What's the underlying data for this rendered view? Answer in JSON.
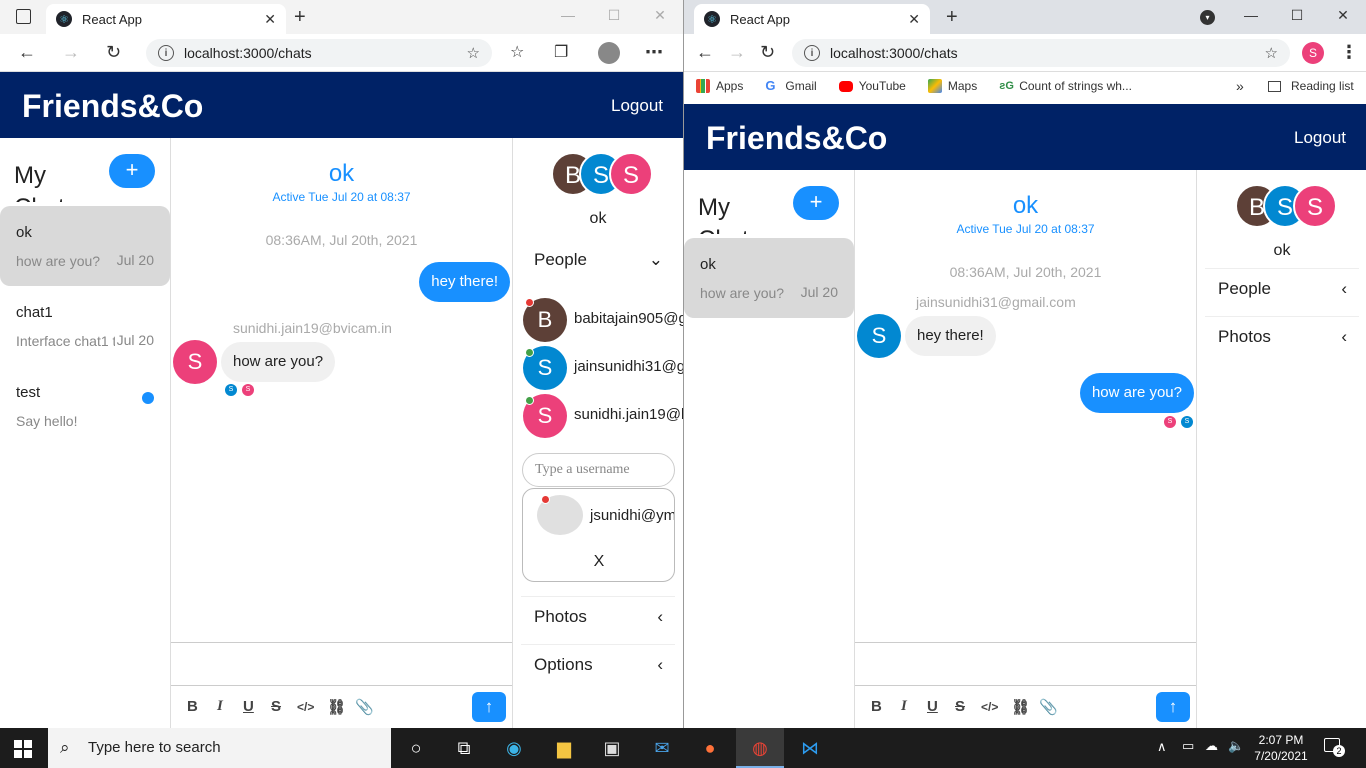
{
  "left_browser": {
    "tab_title": "React App",
    "url": "localhost:3000/chats"
  },
  "right_browser": {
    "tab_title": "React App",
    "url": "localhost:3000/chats",
    "bookmarks": [
      "Apps",
      "Gmail",
      "YouTube",
      "Maps",
      "Count of strings wh..."
    ],
    "reading_list": "Reading list",
    "profile_initial": "S"
  },
  "app": {
    "brand": "Friends&Co",
    "logout": "Logout",
    "my_chats": "My Chats",
    "add_icon": "+",
    "send_icon": "↑"
  },
  "left_app": {
    "chats": [
      {
        "name": "ok",
        "preview": "how are you?",
        "date": "Jul 20"
      },
      {
        "name": "chat1",
        "preview": "Interface chat1 tu",
        "date": "Jul 20"
      },
      {
        "name": "test",
        "preview": "Say hello!",
        "date": ""
      }
    ],
    "feed": {
      "title": "ok",
      "subtitle": "Active Tue Jul 20 at 08:37",
      "timestamp": "08:36AM, Jul 20th, 2021",
      "msg_mine": "hey there!",
      "sender": "sunidhi.jain19@bvicam.in",
      "msg_theirs": "how are you?",
      "sender_initial": "S",
      "read_initials": [
        "S",
        "S"
      ]
    },
    "settings": {
      "avatars": [
        "B",
        "S",
        "S"
      ],
      "title": "ok",
      "people_label": "People",
      "people": [
        {
          "initial": "B",
          "email": "babitajain905@g"
        },
        {
          "initial": "S",
          "email": "jainsunidhi31@g"
        },
        {
          "initial": "S",
          "email": "sunidhi.jain19@b"
        }
      ],
      "username_placeholder": "Type a username",
      "suggestion": "jsunidhi@ym",
      "close": "X",
      "photos_label": "Photos",
      "options_label": "Options"
    }
  },
  "right_app": {
    "chats": [
      {
        "name": "ok",
        "preview": "how are you?",
        "date": "Jul 20"
      }
    ],
    "feed": {
      "title": "ok",
      "subtitle": "Active Tue Jul 20 at 08:37",
      "timestamp": "08:36AM, Jul 20th, 2021",
      "sender": "jainsunidhi31@gmail.com",
      "msg_theirs": "hey there!",
      "sender_initial": "S",
      "msg_mine": "how are you?",
      "read_initials": [
        "S",
        "S"
      ]
    },
    "settings": {
      "avatars": [
        "B",
        "S",
        "S"
      ],
      "title": "ok",
      "people_label": "People",
      "photos_label": "Photos"
    }
  },
  "taskbar": {
    "search_placeholder": "Type here to search",
    "time": "2:07 PM",
    "date": "7/20/2021",
    "notifications": "2"
  },
  "colors": {
    "header": "#002266",
    "accent": "#1890ff",
    "avatar_brown": "#5d4037",
    "avatar_blue": "#0288d1",
    "avatar_pink": "#ec407a"
  }
}
